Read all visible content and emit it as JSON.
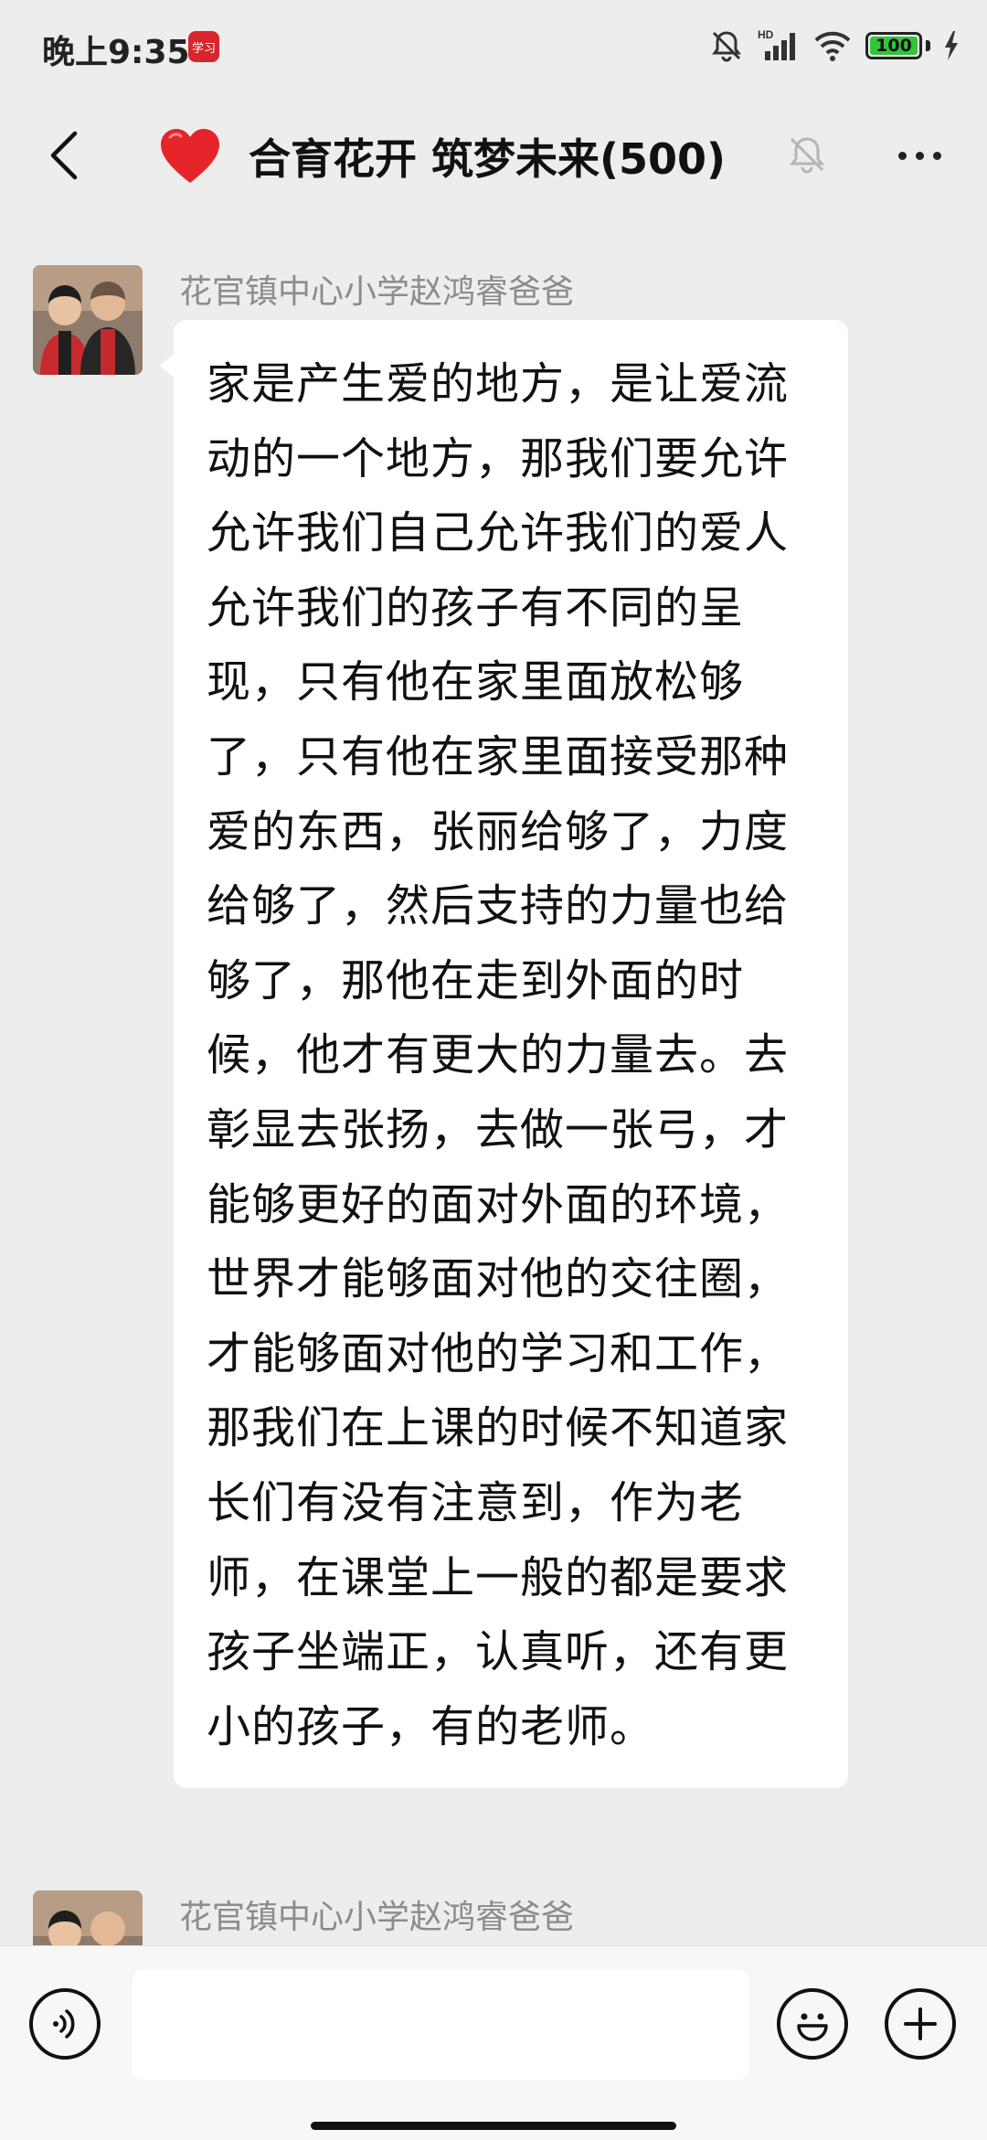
{
  "status_bar": {
    "time": "晚上9:35",
    "app_badge": "学习",
    "battery_level": "100",
    "icons": [
      "mute-bell-icon",
      "hd-signal-icon",
      "wifi-icon",
      "battery-icon",
      "charging-icon"
    ]
  },
  "header": {
    "title": "合育花开 筑梦未来(500)",
    "emoji": "heart",
    "muted": true
  },
  "messages": [
    {
      "sender": "花官镇中心小学赵鸿睿爸爸",
      "text": "家是产生爱的地方，是让爱流动的一个地方，那我们要允许允许我们自己允许我们的爱人允许我们的孩子有不同的呈现，只有他在家里面放松够了，只有他在家里面接受那种爱的东西，张丽给够了，力度给够了，然后支持的力量也给够了，那他在走到外面的时候，他才有更大的力量去。去彰显去张扬，去做一张弓，才能够更好的面对外面的环境，世界才能够面对他的交往圈，才能够面对他的学习和工作，那我们在上课的时候不知道家长们有没有注意到，作为老师，在课堂上一般的都是要求孩子坐端正，认真听，还有更小的孩子，有的老师。"
    },
    {
      "sender": "花官镇中心小学赵鸿睿爸爸",
      "text": ""
    }
  ],
  "input_bar": {
    "voice_icon": "voice-icon",
    "emoji_icon": "emoji-icon",
    "plus_icon": "plus-icon",
    "input_value": ""
  },
  "colors": {
    "background": "#ededed",
    "bubble": "#ffffff",
    "sender_text": "#8c8c8c",
    "badge": "#d8262c",
    "battery_fill": "#33c43a"
  }
}
